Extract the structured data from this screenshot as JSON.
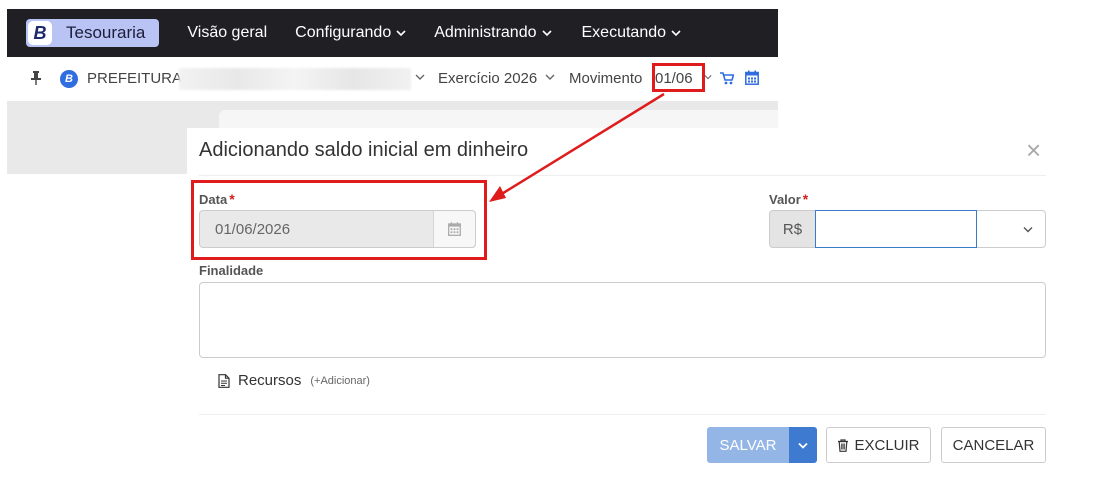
{
  "navbar": {
    "brand_letter": "B",
    "app_name": "Tesouraria",
    "items": [
      {
        "label": "Visão geral",
        "has_dropdown": false
      },
      {
        "label": "Configurando",
        "has_dropdown": true
      },
      {
        "label": "Administrando",
        "has_dropdown": true
      },
      {
        "label": "Executando",
        "has_dropdown": true
      }
    ]
  },
  "context": {
    "entity_prefix": "PREFEITURA",
    "exercicio": "Exercício 2026",
    "movimento_label": "Movimento",
    "movimento_value": "01/06",
    "icons": [
      "pin-icon",
      "cart-icon",
      "calendar-icon"
    ]
  },
  "modal": {
    "title": "Adicionando saldo inicial em dinheiro",
    "close_symbol": "×",
    "fields": {
      "data": {
        "label": "Data",
        "required_mark": "*",
        "value": "01/06/2026"
      },
      "valor": {
        "label": "Valor",
        "required_mark": "*",
        "prefix": "R$",
        "value": ""
      },
      "finalidade": {
        "label": "Finalidade",
        "value": ""
      }
    },
    "recursos": {
      "label": "Recursos",
      "add_link": "(+Adicionar)"
    },
    "buttons": {
      "save": "SALVAR",
      "delete": "EXCLUIR",
      "cancel": "CANCELAR"
    }
  },
  "colors": {
    "navbar_bg": "#1f1f24",
    "brand_bg": "#b9c3f4",
    "primary": "#3d7ad0",
    "highlight": "#e01b1b"
  }
}
